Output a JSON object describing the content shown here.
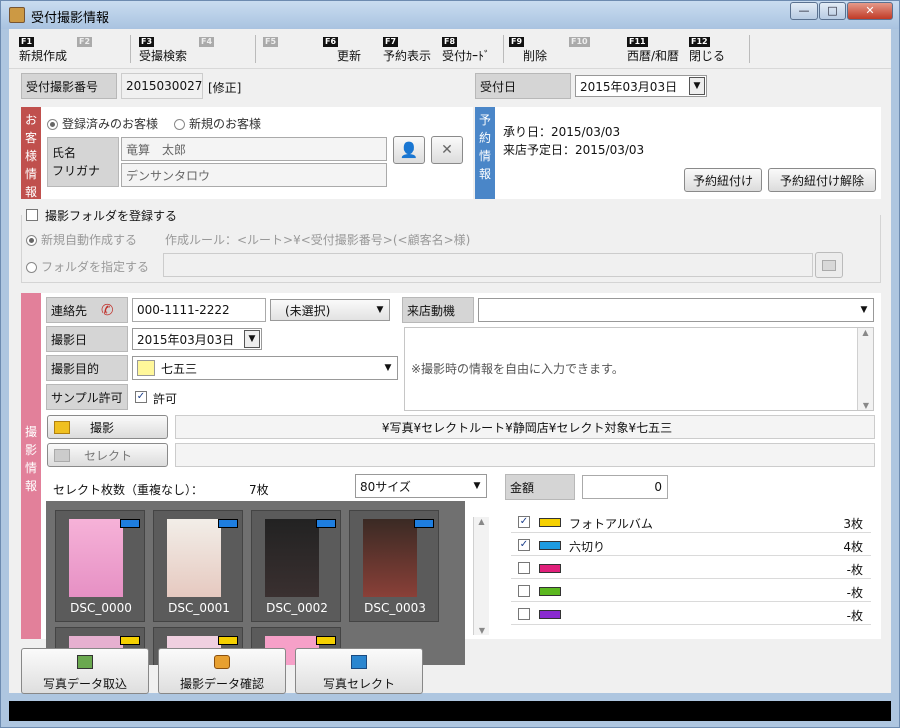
{
  "window": {
    "title": "受付撮影情報",
    "controls": {
      "minimize": "—",
      "maximize": "□",
      "close": "✕"
    }
  },
  "fkeys": [
    {
      "key": "F1",
      "label": "新規作成",
      "enabled": true
    },
    {
      "key": "F2",
      "label": "",
      "enabled": false
    },
    {
      "key": "F3",
      "label": "受撮検索",
      "enabled": true
    },
    {
      "key": "F4",
      "label": "",
      "enabled": false
    },
    {
      "key": "F5",
      "label": "",
      "enabled": false
    },
    {
      "key": "F6",
      "label": "更新",
      "enabled": true
    },
    {
      "key": "F7",
      "label": "予約表示",
      "enabled": true
    },
    {
      "key": "F8",
      "label": "受付ｶｰﾄﾞ",
      "enabled": true
    },
    {
      "key": "F9",
      "label": "削除",
      "enabled": true
    },
    {
      "key": "F10",
      "label": "",
      "enabled": false
    },
    {
      "key": "F11",
      "label": "西暦/和暦",
      "enabled": true
    },
    {
      "key": "F12",
      "label": "閉じる",
      "enabled": true
    }
  ],
  "header": {
    "reception_no_label": "受付撮影番号",
    "reception_no": "2015030027",
    "edit_mode": "[修正]",
    "reception_date_label": "受付日",
    "reception_date": "2015年03月03日"
  },
  "customer": {
    "tab_label": "お客様情報",
    "radio_registered": "登録済みのお客様",
    "radio_new": "新規のお客様",
    "name_label": "氏名",
    "furigana_label": "フリガナ",
    "name": "竜算　太郎",
    "furigana": "デンサンタロウ"
  },
  "reservation": {
    "tab_label": "予約情報",
    "accepted": "承り日：2015/03/03",
    "visit": "来店予定日：2015/03/03",
    "link_button": "予約紐付け",
    "unlink_button": "予約紐付け解除"
  },
  "folder": {
    "register_label": "撮影フォルダを登録する",
    "auto_label": "新規自動作成する",
    "rule_text": "作成ルール：<ルート>¥<受付撮影番号>(<顧客名>様)",
    "specify_label": "フォルダを指定する",
    "path": ""
  },
  "shoot": {
    "tab_label": "撮影情報",
    "contact_label": "連絡先",
    "contact_value": "000-1111-2222",
    "contact_type": "(未選択)",
    "visit_reason_label": "来店動機",
    "visit_reason": "",
    "date_label": "撮影日",
    "date_value": "2015年03月03日",
    "purpose_label": "撮影目的",
    "purpose_value": "七五三",
    "memo_placeholder": "※撮影時の情報を自由に入力できます。",
    "sample_label": "サンプル許可",
    "sample_check": "許可",
    "shoot_button": "撮影",
    "select_button": "セレクト",
    "shoot_path": "¥写真¥セレクトルート¥静岡店¥セレクト対象¥七五三",
    "select_path": "",
    "select_count_label": "セレクト枚数（重複なし）：",
    "select_count": "7枚",
    "size_value": "80サイズ",
    "amount_label": "金額",
    "amount_value": "0"
  },
  "thumbnails": [
    {
      "name": "DSC_0000"
    },
    {
      "name": "DSC_0001"
    },
    {
      "name": "DSC_0002"
    },
    {
      "name": "DSC_0003"
    }
  ],
  "products": [
    {
      "name": "フォトアルバム",
      "count": "3枚",
      "checked": true,
      "color": "#f5d000"
    },
    {
      "name": "六切り",
      "count": "4枚",
      "checked": true,
      "color": "#1e9be0"
    },
    {
      "name": "",
      "count": "-枚",
      "checked": false,
      "color": "#e0207a"
    },
    {
      "name": "",
      "count": "-枚",
      "checked": false,
      "color": "#5cb820"
    },
    {
      "name": "",
      "count": "-枚",
      "checked": false,
      "color": "#8a2ad0"
    }
  ],
  "bottom_buttons": {
    "import": "写真データ取込",
    "confirm": "撮影データ確認",
    "select": "写真セレクト"
  }
}
